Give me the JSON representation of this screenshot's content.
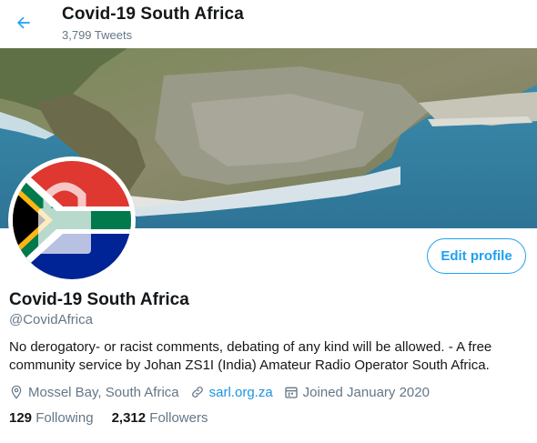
{
  "header": {
    "title": "Covid-19 South Africa",
    "tweet_count": "3,799 Tweets",
    "back_icon": "arrow-left-icon"
  },
  "profile": {
    "name": "Covid-19 South Africa",
    "handle": "@CovidAfrica",
    "bio": "No derogatory- or racist comments, debating of any kind will be allowed.  -  A free community service by Johan ZS1I (India) Amateur Radio Operator South Africa.",
    "location": "Mossel Bay, South Africa",
    "website": "sarl.org.za",
    "joined": "Joined January 2020",
    "edit_label": "Edit profile"
  },
  "stats": {
    "following_count": "129",
    "following_label": "Following",
    "followers_count": "2,312",
    "followers_label": "Followers"
  },
  "colors": {
    "accent": "#1da1f2",
    "link": "#1b95e0",
    "secondary_text": "#657786"
  }
}
